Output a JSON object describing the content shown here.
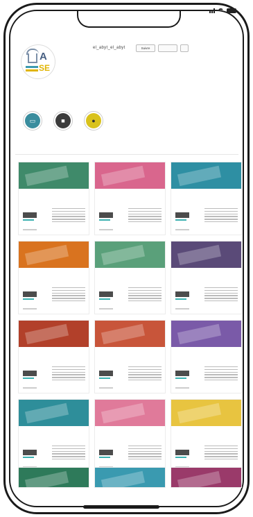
{
  "profile": {
    "username": "el_abyt_el_abyt",
    "follow_label": "Suivre",
    "message_label": "",
    "stats": [
      "",
      "",
      ""
    ],
    "name": "",
    "bio": "",
    "bio_link": ""
  },
  "highlights": [
    {
      "label": "",
      "color": "#3a8d9e",
      "icon": "monitor-icon"
    },
    {
      "label": "",
      "color": "#3b3b3b",
      "icon": "briefcase-icon"
    },
    {
      "label": "",
      "color": "#d9c21c",
      "icon": "handshake-icon"
    }
  ],
  "tabs": [
    "",
    "",
    ""
  ],
  "posts": [
    {
      "color": "#3f8a6a",
      "tag": "",
      "title": "",
      "sub": ""
    },
    {
      "color": "#d9668d",
      "tag": "",
      "title": "",
      "sub": ""
    },
    {
      "color": "#2e8fa3",
      "tag": "",
      "title": "",
      "sub": ""
    },
    {
      "color": "#d9731f",
      "tag": "",
      "title": "",
      "sub": ""
    },
    {
      "color": "#5aa07a",
      "tag": "",
      "title": "",
      "sub": ""
    },
    {
      "color": "#5a4a78",
      "tag": "",
      "title": "",
      "sub": ""
    },
    {
      "color": "#b2402a",
      "tag": "",
      "title": "",
      "sub": ""
    },
    {
      "color": "#c8553a",
      "tag": "",
      "title": "",
      "sub": ""
    },
    {
      "color": "#7a5aa8",
      "tag": "",
      "title": "",
      "sub": ""
    },
    {
      "color": "#2e8e9a",
      "tag": "",
      "title": "",
      "sub": ""
    },
    {
      "color": "#e07a9a",
      "tag": "",
      "title": "",
      "sub": ""
    },
    {
      "color": "#e8c440",
      "tag": "",
      "title": "",
      "sub": ""
    }
  ],
  "posts_partial": [
    {
      "color": "#2e7a5a"
    },
    {
      "color": "#3a9ab0"
    },
    {
      "color": "#9a3a6a"
    }
  ],
  "colors": {
    "accent": "#1d5fb8",
    "frame": "#1a1a1a"
  }
}
